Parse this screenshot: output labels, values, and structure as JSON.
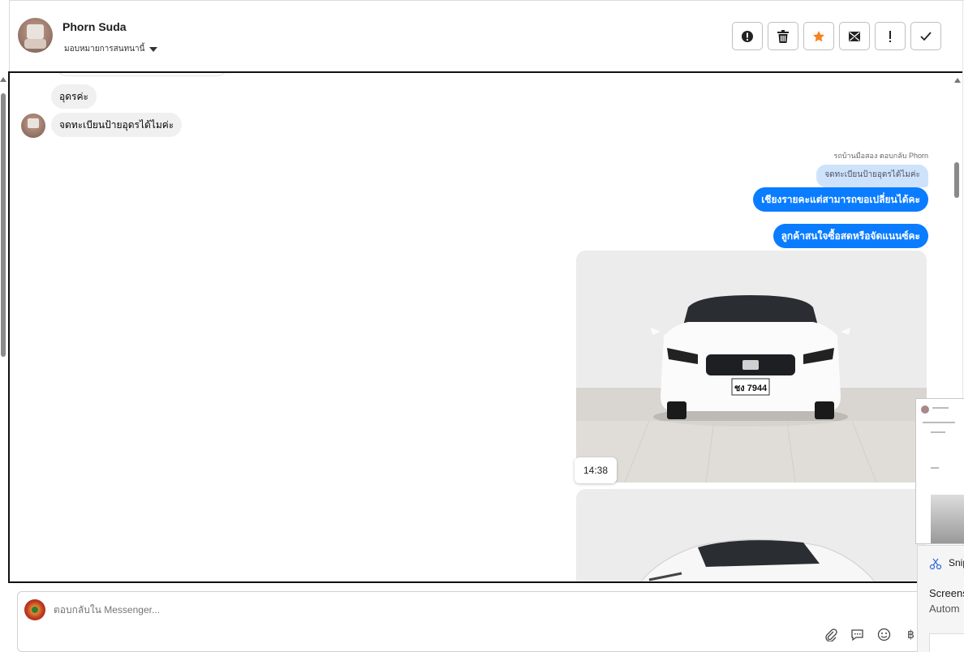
{
  "header": {
    "contact_name": "Phorn Suda",
    "assign_label": "มอบหมายการสนทนานี้",
    "actions": [
      {
        "name": "spam-icon"
      },
      {
        "name": "trash-icon"
      },
      {
        "name": "star-icon",
        "color": "#f5841f"
      },
      {
        "name": "mark-unread-icon"
      },
      {
        "name": "follow-up-icon"
      },
      {
        "name": "done-icon"
      }
    ]
  },
  "chat": {
    "incoming": [
      {
        "text": "อุดรค่ะ"
      },
      {
        "text": "จดทะเบียนป้ายอุดรได้ไมค่ะ"
      }
    ],
    "reply_note": "รถบ้านมือสอง ตอบกลับ Phorn",
    "quoted_text": "จดทะเบียนป้ายอุดรได้ไมค่ะ",
    "outgoing": [
      {
        "text": "เชียงรายคะแต่สามารถขอเปลี่ยนได้คะ"
      },
      {
        "text": "ลูกค้าสนใจซื้อสดหรือจัดแนนซ์คะ"
      }
    ],
    "photo_timestamp": "14:38",
    "plate_text": "ชง 7944",
    "outgoing_color": "#0a7cff"
  },
  "composer": {
    "placeholder": "ตอบกลับใน Messenger...",
    "tools": [
      {
        "name": "attach-icon"
      },
      {
        "name": "saved-replies-icon"
      },
      {
        "name": "emoji-icon"
      },
      {
        "name": "payment-icon",
        "glyph": "฿"
      }
    ]
  },
  "snip": {
    "title": "Snip",
    "line1": "Screens",
    "line2": "Autom"
  }
}
